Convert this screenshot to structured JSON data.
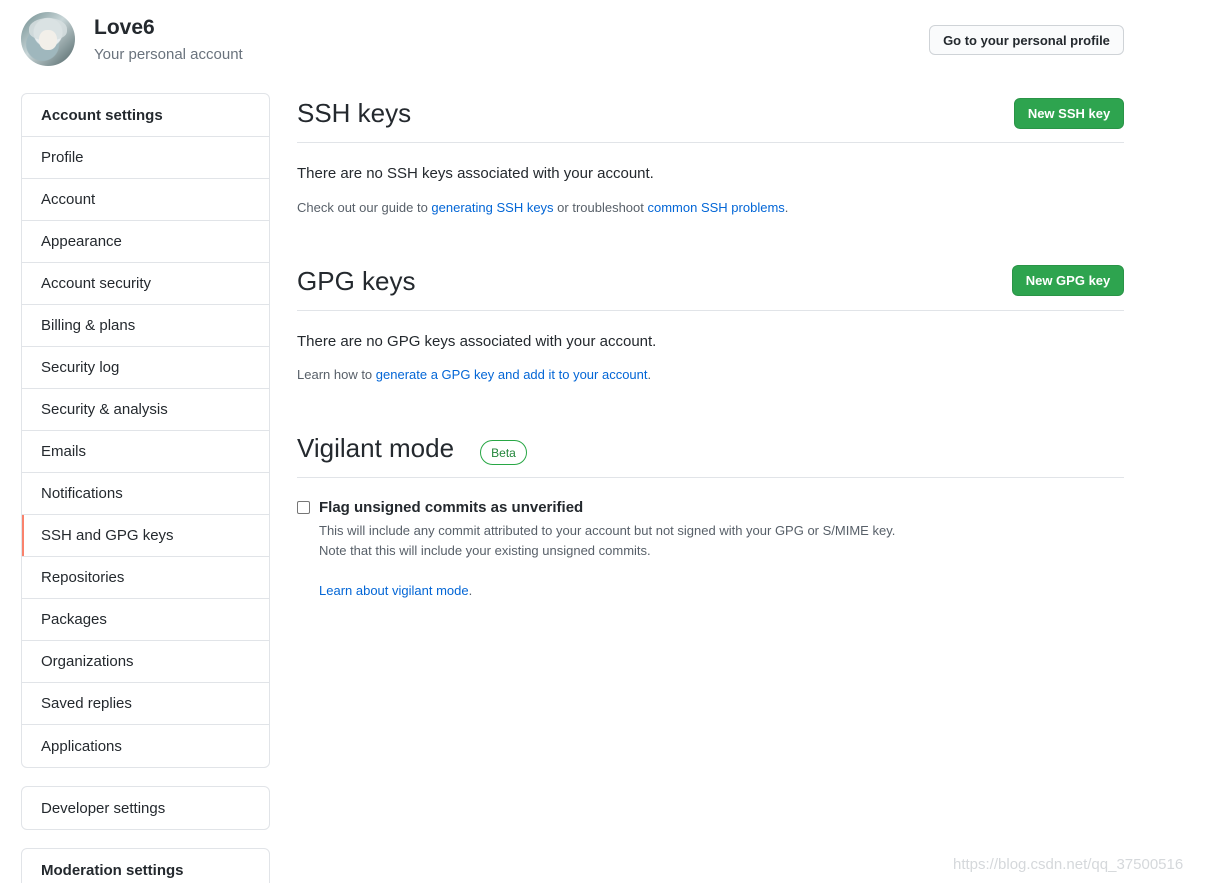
{
  "header": {
    "user_name": "Love6",
    "subtitle": "Your personal account",
    "profile_button": "Go to your personal profile"
  },
  "sidebar": {
    "account_heading": "Account settings",
    "items": [
      {
        "label": "Profile"
      },
      {
        "label": "Account"
      },
      {
        "label": "Appearance"
      },
      {
        "label": "Account security"
      },
      {
        "label": "Billing & plans"
      },
      {
        "label": "Security log"
      },
      {
        "label": "Security & analysis"
      },
      {
        "label": "Emails"
      },
      {
        "label": "Notifications"
      },
      {
        "label": "SSH and GPG keys",
        "selected": true
      },
      {
        "label": "Repositories"
      },
      {
        "label": "Packages"
      },
      {
        "label": "Organizations"
      },
      {
        "label": "Saved replies"
      },
      {
        "label": "Applications"
      }
    ],
    "developer_settings": "Developer settings",
    "moderation_heading": "Moderation settings"
  },
  "ssh": {
    "title": "SSH keys",
    "new_button": "New SSH key",
    "empty_text": "There are no SSH keys associated with your account.",
    "guide_prefix": "Check out our guide to ",
    "guide_link1": "generating SSH keys",
    "guide_middle": " or troubleshoot ",
    "guide_link2": "common SSH problems",
    "guide_suffix": "."
  },
  "gpg": {
    "title": "GPG keys",
    "new_button": "New GPG key",
    "empty_text": "There are no GPG keys associated with your account.",
    "learn_prefix": "Learn how to ",
    "learn_link": "generate a GPG key and add it to your account",
    "learn_suffix": "."
  },
  "vigilant": {
    "title": "Vigilant mode",
    "badge": "Beta",
    "checkbox_label": "Flag unsigned commits as unverified",
    "checked": false,
    "note_line1": "This will include any commit attributed to your account but not signed with your GPG or S/MIME key.",
    "note_line2": "Note that this will include your existing unsigned commits.",
    "learn_link": "Learn about vigilant mode",
    "learn_suffix": "."
  },
  "colors": {
    "accent_green": "#2ea44f",
    "link_blue": "#0366d6",
    "selected_marker": "#f9826c"
  },
  "watermark": "https://blog.csdn.net/qq_37500516"
}
